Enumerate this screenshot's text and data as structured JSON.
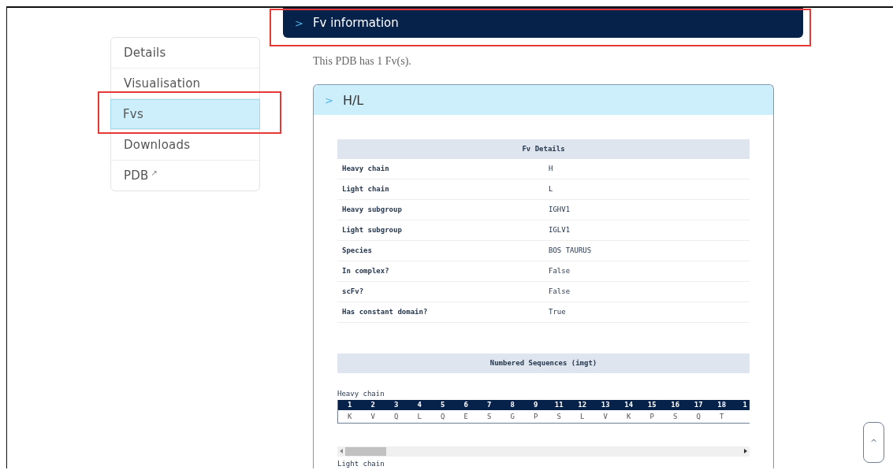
{
  "sidebar": {
    "items": [
      {
        "label": "Details",
        "selected": false,
        "highlighted": false
      },
      {
        "label": "Visualisation",
        "selected": false,
        "highlighted": false
      },
      {
        "label": "Fvs",
        "selected": true,
        "highlighted": true
      },
      {
        "label": "Downloads",
        "selected": false,
        "highlighted": false
      },
      {
        "label": "PDB",
        "selected": false,
        "highlighted": false,
        "link_icon": "↗"
      }
    ]
  },
  "section": {
    "title": "Fv information",
    "marker": ">",
    "highlighted": true
  },
  "summary": "This PDB has 1 Fv(s).",
  "fv_card": {
    "title": "H/L",
    "marker": ">",
    "details": {
      "heading": "Fv Details",
      "rows": [
        {
          "label": "Heavy chain",
          "value": "H"
        },
        {
          "label": "Light chain",
          "value": "L"
        },
        {
          "label": "Heavy subgroup",
          "value": "IGHV1"
        },
        {
          "label": "Light subgroup",
          "value": "IGLV1"
        },
        {
          "label": "Species",
          "value": "BOS TAURUS"
        },
        {
          "label": "In complex?",
          "value": "False"
        },
        {
          "label": "scFv?",
          "value": "False"
        },
        {
          "label": "Has constant domain?",
          "value": "True"
        }
      ]
    },
    "sequences": {
      "heading": "Numbered Sequences (imgt)",
      "heavy_label": "Heavy chain",
      "positions": [
        "1",
        "2",
        "3",
        "4",
        "5",
        "6",
        "7",
        "8",
        "9",
        "11",
        "12",
        "13",
        "14",
        "15",
        "16",
        "17",
        "18",
        "1"
      ],
      "residues": [
        "K",
        "V",
        "Q",
        "L",
        "Q",
        "E",
        "S",
        "G",
        "P",
        "S",
        "L",
        "V",
        "K",
        "P",
        "S",
        "Q",
        "T"
      ],
      "light_label": "Light chain"
    }
  },
  "scroll_top": {
    "label": "^"
  }
}
